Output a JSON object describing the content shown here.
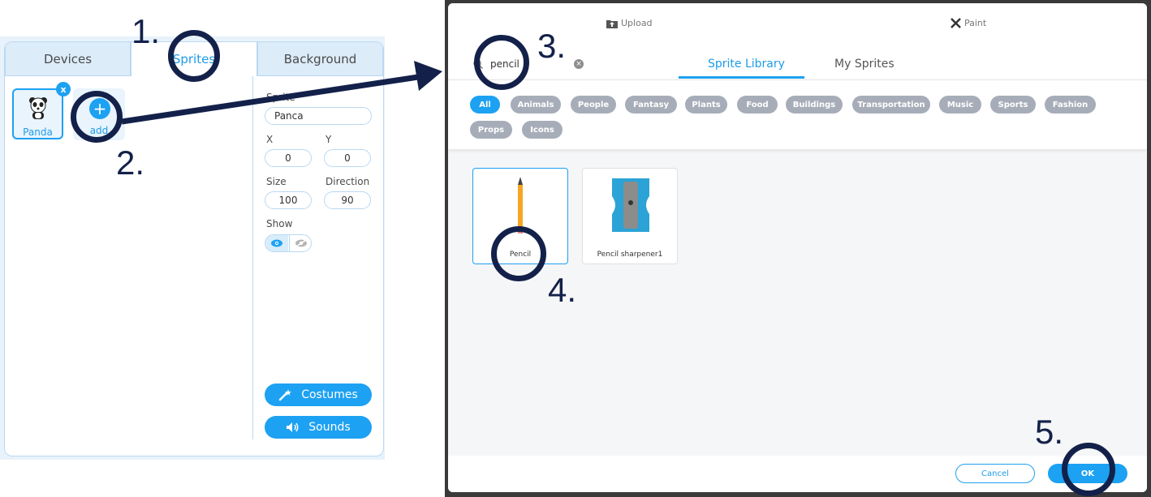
{
  "left_panel": {
    "tabs": [
      {
        "label": "Devices",
        "active": false
      },
      {
        "label": "Sprites",
        "active": true
      },
      {
        "label": "Background",
        "active": false
      }
    ],
    "sprite": {
      "name": "Panda",
      "delete_label": "x",
      "icon": "panda-icon"
    },
    "add_label": "add",
    "add_icon": "+",
    "props": {
      "sprite_label": "Sprite",
      "sprite_value": "Panca",
      "x_label": "X",
      "x_value": "0",
      "y_label": "Y",
      "y_value": "0",
      "size_label": "Size",
      "size_value": "100",
      "direction_label": "Direction",
      "direction_value": "90",
      "show_label": "Show"
    },
    "costumes_label": "Costumes",
    "sounds_label": "Sounds"
  },
  "dialog": {
    "upload_label": "Upload",
    "paint_label": "Paint",
    "search_value": "pencil",
    "tabs": [
      {
        "label": "Sprite Library",
        "active": true
      },
      {
        "label": "My Sprites",
        "active": false
      }
    ],
    "categories": [
      "All",
      "Animals",
      "People",
      "Fantasy",
      "Plants",
      "Food",
      "Buildings",
      "Transportation",
      "Music",
      "Sports",
      "Fashion",
      "Props",
      "Icons"
    ],
    "results": [
      {
        "name": "Pencil",
        "selected": true
      },
      {
        "name": "Pencil sharpener1",
        "selected": false
      }
    ],
    "cancel_label": "Cancel",
    "ok_label": "OK"
  },
  "annotations": {
    "step1": "1.",
    "step2": "2.",
    "step3": "3.",
    "step4": "4.",
    "step5": "5."
  },
  "colors": {
    "accent": "#1da1f2",
    "annotation": "#13214a",
    "chip_gray": "#a7adb8"
  }
}
